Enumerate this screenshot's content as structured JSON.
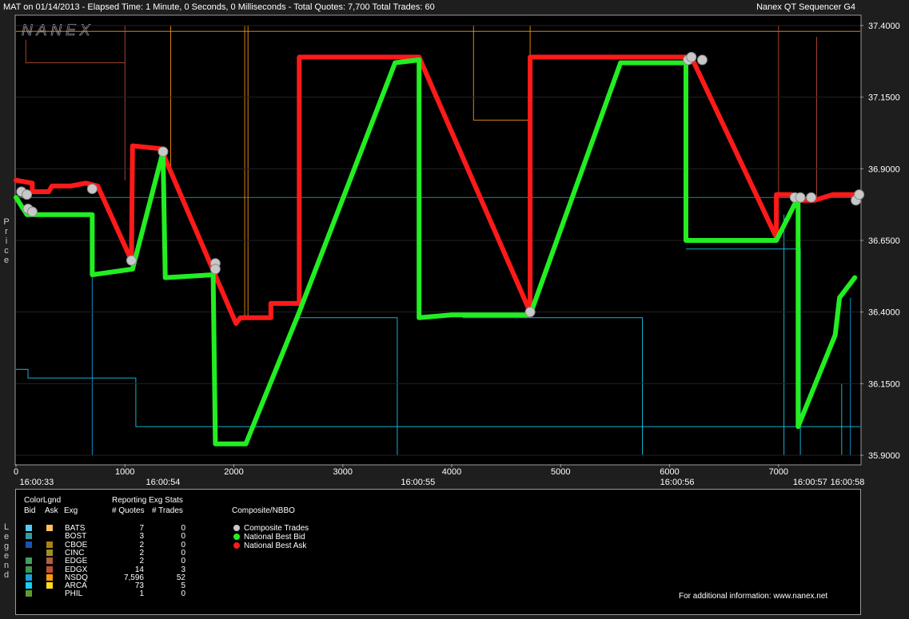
{
  "header": {
    "left": "MAT on 01/14/2013  -  Elapsed Time: 1 Minute, 0 Seconds, 0 Milliseconds  -  Total Quotes: 7,700  Total Trades: 60",
    "right": "Nanex QT Sequencer G4"
  },
  "watermark": "NANEX",
  "side_labels": {
    "price": "Price",
    "legend": "Legend"
  },
  "chart_data": {
    "type": "line",
    "ylim": [
      35.9,
      37.4
    ],
    "xlim": [
      0,
      7750
    ],
    "y_ticks": [
      "35.9000",
      "36.1500",
      "36.4000",
      "36.6500",
      "36.9000",
      "37.1500",
      "37.4000"
    ],
    "y_tick_values": [
      35.9,
      36.15,
      36.4,
      36.65,
      36.9,
      37.15,
      37.4
    ],
    "x_ticks": [
      "0",
      "1000",
      "2000",
      "3000",
      "4000",
      "5000",
      "6000",
      "7000"
    ],
    "x_tick_values": [
      0,
      1000,
      2000,
      3000,
      4000,
      5000,
      6000,
      7000
    ],
    "time_labels": [
      {
        "x": 190,
        "label": "16:00:33"
      },
      {
        "x": 1350,
        "label": "16:00:54"
      },
      {
        "x": 3690,
        "label": "16:00:55"
      },
      {
        "x": 6070,
        "label": "16:00:56"
      },
      {
        "x": 7290,
        "label": "16:00:57"
      },
      {
        "x": 7730,
        "label": "16:00:58"
      }
    ],
    "series": [
      {
        "name": "National Best Ask",
        "color": "#ff1a1a",
        "points": [
          [
            0,
            36.86
          ],
          [
            150,
            36.85
          ],
          [
            150,
            36.82
          ],
          [
            300,
            36.82
          ],
          [
            330,
            36.84
          ],
          [
            500,
            36.84
          ],
          [
            640,
            36.85
          ],
          [
            750,
            36.84
          ],
          [
            1060,
            36.58
          ],
          [
            1070,
            36.98
          ],
          [
            1330,
            36.97
          ],
          [
            2020,
            36.36
          ],
          [
            2060,
            36.38
          ],
          [
            2340,
            36.38
          ],
          [
            2340,
            36.43
          ],
          [
            2600,
            36.43
          ],
          [
            2600,
            37.29
          ],
          [
            3700,
            37.29
          ],
          [
            4720,
            36.4
          ],
          [
            4720,
            37.29
          ],
          [
            6200,
            37.29
          ],
          [
            6980,
            36.66
          ],
          [
            6980,
            36.81
          ],
          [
            7120,
            36.81
          ],
          [
            7200,
            36.79
          ],
          [
            7330,
            36.79
          ],
          [
            7500,
            36.81
          ],
          [
            7750,
            36.81
          ]
        ]
      },
      {
        "name": "National Best Bid",
        "color": "#22ee22",
        "points": [
          [
            0,
            36.8
          ],
          [
            100,
            36.74
          ],
          [
            700,
            36.74
          ],
          [
            700,
            36.53
          ],
          [
            1070,
            36.55
          ],
          [
            1350,
            36.96
          ],
          [
            1370,
            36.52
          ],
          [
            1810,
            36.53
          ],
          [
            1830,
            35.94
          ],
          [
            2110,
            35.94
          ],
          [
            2600,
            36.4
          ],
          [
            3480,
            37.27
          ],
          [
            3700,
            37.28
          ],
          [
            3700,
            36.38
          ],
          [
            4000,
            36.39
          ],
          [
            4720,
            36.39
          ],
          [
            5550,
            37.27
          ],
          [
            6150,
            37.27
          ],
          [
            6150,
            36.65
          ],
          [
            6980,
            36.65
          ],
          [
            7180,
            36.8
          ],
          [
            7180,
            36.0
          ],
          [
            7520,
            36.32
          ],
          [
            7560,
            36.45
          ],
          [
            7700,
            36.52
          ]
        ]
      }
    ],
    "trades": [
      [
        50,
        36.82
      ],
      [
        100,
        36.81
      ],
      [
        110,
        36.76
      ],
      [
        150,
        36.75
      ],
      [
        700,
        36.83
      ],
      [
        1060,
        36.58
      ],
      [
        1350,
        36.96
      ],
      [
        1830,
        36.57
      ],
      [
        1830,
        36.55
      ],
      [
        4720,
        36.4
      ],
      [
        6170,
        37.28
      ],
      [
        6200,
        37.29
      ],
      [
        6300,
        37.28
      ],
      [
        7150,
        36.8
      ],
      [
        7200,
        36.8
      ],
      [
        7300,
        36.8
      ],
      [
        7710,
        36.79
      ],
      [
        7740,
        36.81
      ]
    ]
  },
  "legend": {
    "color_legend_header": "ColorLgnd",
    "bid_header": "Bid",
    "ask_header": "Ask",
    "exg_header": "Exg",
    "stats_header": "Reporting Exg Stats",
    "quotes_header": "# Quotes",
    "trades_header": "# Trades",
    "exchanges": [
      {
        "exg": "BATS",
        "bid_color": "#5bc8f0",
        "ask_color": "#ffc060",
        "quotes": "7",
        "trades": "0"
      },
      {
        "exg": "BOST",
        "bid_color": "#3a9a9a",
        "ask_color": "",
        "quotes": "3",
        "trades": "0"
      },
      {
        "exg": "CBOE",
        "bid_color": "#2050b0",
        "ask_color": "#b08010",
        "quotes": "2",
        "trades": "0"
      },
      {
        "exg": "CINC",
        "bid_color": "",
        "ask_color": "#a09020",
        "quotes": "2",
        "trades": "0"
      },
      {
        "exg": "EDGE",
        "bid_color": "#40a060",
        "ask_color": "#b06040",
        "quotes": "2",
        "trades": "0"
      },
      {
        "exg": "EDGX",
        "bid_color": "#3a9a50",
        "ask_color": "#c05030",
        "quotes": "14",
        "trades": "3"
      },
      {
        "exg": "NSDQ",
        "bid_color": "#1aa0e0",
        "ask_color": "#ff9a10",
        "quotes": "7,596",
        "trades": "52"
      },
      {
        "exg": "ARCA",
        "bid_color": "#18d0f0",
        "ask_color": "#ffe020",
        "quotes": "73",
        "trades": "5"
      },
      {
        "exg": "PHIL",
        "bid_color": "#609a30",
        "ask_color": "",
        "quotes": "1",
        "trades": "0"
      }
    ],
    "composite_header": "Composite/NBBO",
    "composite_items": [
      {
        "label": "Composite Trades",
        "color": "#c8c8c8"
      },
      {
        "label": "National Best Bid",
        "color": "#22ee22"
      },
      {
        "label": "National Best Ask",
        "color": "#ff1a1a"
      }
    ],
    "footer": "For additional information: www.nanex.net"
  }
}
